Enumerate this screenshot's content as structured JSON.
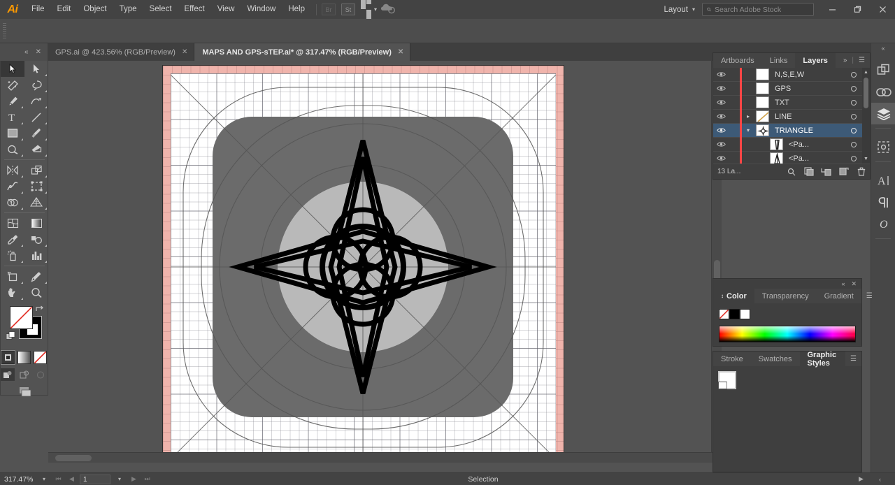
{
  "app": {
    "logo": "Ai",
    "menus": [
      "File",
      "Edit",
      "Object",
      "Type",
      "Select",
      "Effect",
      "View",
      "Window",
      "Help"
    ],
    "bridge_label": "Br",
    "stock_label": "St",
    "arrange_label": "arrange-documents",
    "layout_label": "Layout",
    "search": {
      "placeholder": "Search Adobe Stock",
      "value": ""
    },
    "window_controls": {
      "minimize": "—",
      "maximize": "❐",
      "close": "✕"
    }
  },
  "tabs": {
    "collapse_icon": "«",
    "close_icon": "✕",
    "items": [
      {
        "label": "GPS.ai @ 423.56% (RGB/Preview)",
        "active": false,
        "close": "✕"
      },
      {
        "label": "MAPS AND GPS-sTEP.ai* @ 317.47% (RGB/Preview)",
        "active": true,
        "close": "✕"
      }
    ]
  },
  "toolbar": {
    "tools": [
      "selection-tool",
      "direct-selection-tool",
      "magic-wand-tool",
      "lasso-tool",
      "pen-tool",
      "curvature-tool",
      "type-tool",
      "line-segment-tool",
      "rectangle-tool",
      "paintbrush-tool",
      "shaper-tool",
      "eraser-tool",
      "rotate-tool",
      "scale-tool",
      "width-tool",
      "free-transform-tool",
      "shape-builder-tool",
      "perspective-grid-tool",
      "mesh-tool",
      "gradient-tool",
      "eyedropper-tool",
      "blend-tool",
      "symbol-sprayer-tool",
      "column-graph-tool",
      "artboard-tool",
      "slice-tool",
      "hand-tool",
      "zoom-tool"
    ],
    "active_tool": "selection-tool",
    "fill_label": "fill-none",
    "stroke_label": "stroke-black",
    "color_modes": [
      "color-mode",
      "gradient-mode",
      "none-mode"
    ],
    "draw_modes": [
      "draw-normal",
      "draw-behind",
      "draw-inside"
    ],
    "screen_mode": "change-screen-mode"
  },
  "canvas": {
    "document_title": "MAPS AND GPS-sTEP.ai",
    "artwork_name": "compass-rose-icon-grid",
    "bleed_color": "#f0b4ac",
    "page_color": "#ffffff",
    "icon_tile_color": "#6b6b6b",
    "inner_circle_color": "#b9b9b9",
    "stroke_color": "#000000"
  },
  "panels": {
    "layers": {
      "tabs": [
        "Artboards",
        "Links",
        "Layers"
      ],
      "active_tab": "Layers",
      "collapse_icon": "»",
      "menu_icon": "☰",
      "rows": [
        {
          "name": "N,S,E,W",
          "visible": true,
          "expandable": false,
          "expanded": false,
          "selected": false,
          "indent": 0,
          "thumb": "blank"
        },
        {
          "name": "GPS",
          "visible": true,
          "expandable": false,
          "expanded": false,
          "selected": false,
          "indent": 0,
          "thumb": "blank"
        },
        {
          "name": "TXT",
          "visible": true,
          "expandable": false,
          "expanded": false,
          "selected": false,
          "indent": 0,
          "thumb": "blank"
        },
        {
          "name": "LINE",
          "visible": true,
          "expandable": true,
          "expanded": false,
          "selected": false,
          "indent": 0,
          "thumb": "line"
        },
        {
          "name": "TRIANGLE",
          "visible": true,
          "expandable": true,
          "expanded": true,
          "selected": true,
          "indent": 0,
          "thumb": "compass"
        },
        {
          "name": "<Pa...",
          "visible": true,
          "expandable": false,
          "expanded": false,
          "selected": false,
          "indent": 1,
          "thumb": "path-v"
        },
        {
          "name": "<Pa...",
          "visible": true,
          "expandable": false,
          "expanded": false,
          "selected": false,
          "indent": 1,
          "thumb": "path-a"
        }
      ],
      "footer": {
        "count_label": "13 La...",
        "buttons": [
          "locate-object-icon",
          "make-clipping-mask-icon",
          "create-new-sublayer-icon",
          "create-new-layer-icon",
          "delete-selection-icon"
        ]
      },
      "selection_color": "#3d5a77",
      "layer_color": "#ff4646"
    },
    "color": {
      "tabs": [
        "Color",
        "Transparency",
        "Gradient"
      ],
      "active_tab": "Color",
      "menu_icon": "☰",
      "collapse_icon": "«",
      "close_icon": "✕",
      "swatches": [
        "none",
        "black",
        "white"
      ],
      "spectrum_name": "color-spectrum-ramp"
    },
    "styles": {
      "tabs": [
        "Stroke",
        "Swatches",
        "Graphic Styles"
      ],
      "active_tab": "Graphic Styles",
      "menu_icon": "☰",
      "items": [
        "default-graphic-style"
      ]
    }
  },
  "dock": {
    "collapse_icon": "«",
    "groups": [
      {
        "label": "",
        "icons": [
          "artboards-icon",
          "links-icon",
          "layers-icon"
        ],
        "active": "layers-icon"
      },
      {
        "label": "",
        "icons": [
          "symbols-icon"
        ],
        "active": ""
      },
      {
        "label": "",
        "icons": [
          "character-icon",
          "paragraph-icon",
          "glyphs-icon"
        ],
        "active": ""
      }
    ]
  },
  "statusbar": {
    "zoom": "317.47%",
    "zoom_dropdown": "▾",
    "first_page": "⏮",
    "prev_page": "◀",
    "page": "1",
    "page_dropdown": "▾",
    "next_page": "▶",
    "last_page": "⏭",
    "tool_label": "Selection",
    "play_icon": "▶",
    "more_icon": "‹"
  }
}
